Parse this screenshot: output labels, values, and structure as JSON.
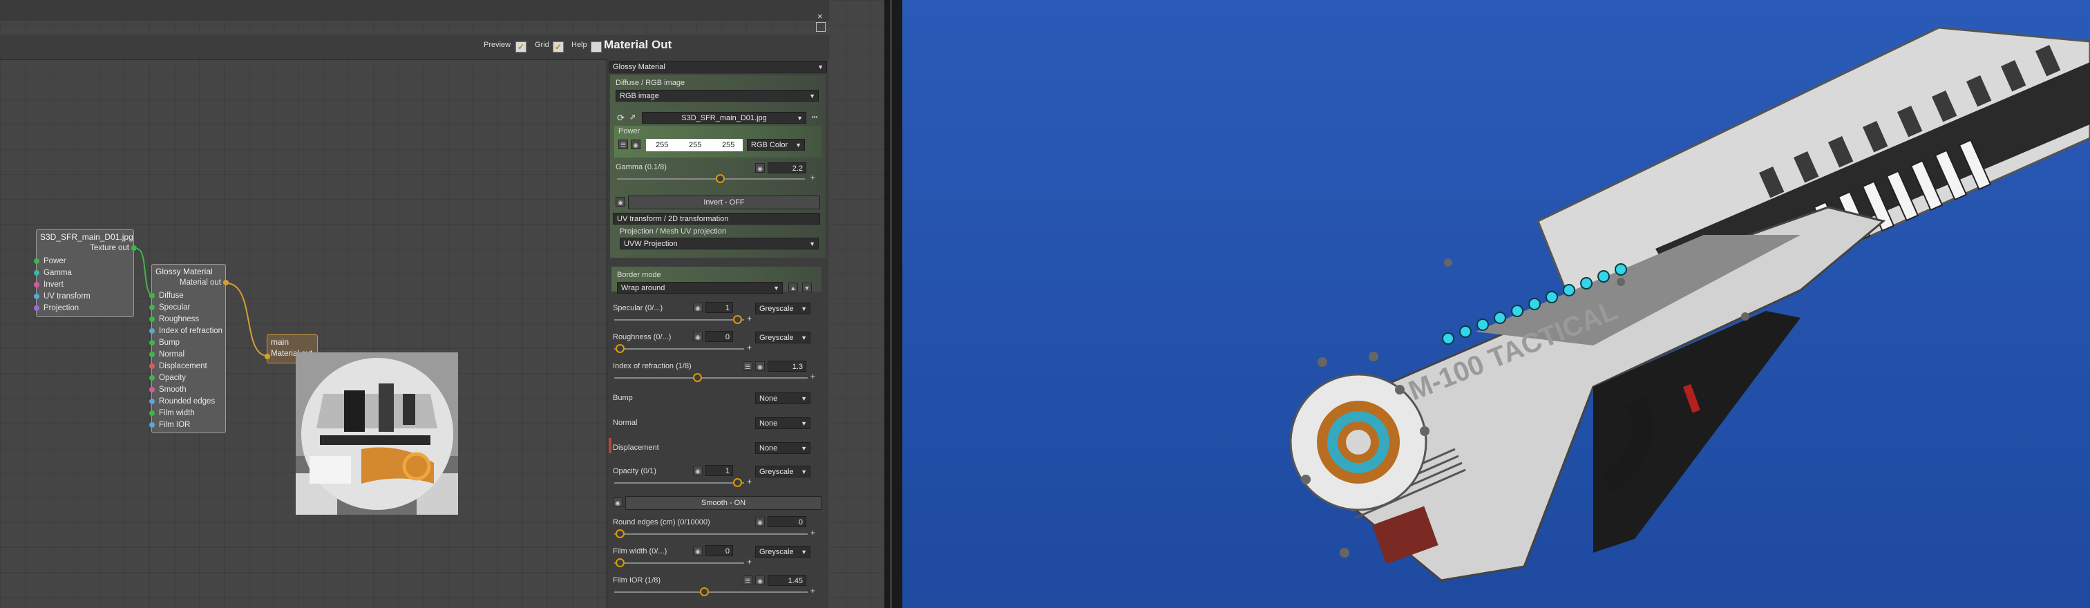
{
  "toolbar": {
    "preview_label": "Preview",
    "grid_label": "Grid",
    "help_label": "Help",
    "panel_title": "Material Out",
    "check_glyph": "✓"
  },
  "nodes": {
    "texture": {
      "title": "S3D_SFR_main_D01.jpg",
      "output": "Texture out",
      "inputs": [
        "Power",
        "Gamma",
        "Invert",
        "UV transform",
        "Projection"
      ]
    },
    "glossy": {
      "title": "Glossy Material",
      "output": "Material out",
      "inputs": [
        "Diffuse",
        "Specular",
        "Roughness",
        "Index of refraction",
        "Bump",
        "Normal",
        "Displacement",
        "Opacity",
        "Smooth",
        "Rounded edges",
        "Film width",
        "Film IOR"
      ]
    },
    "main": {
      "title": "main",
      "input": "Material out"
    }
  },
  "panel": {
    "material_type": "Glossy Material",
    "diffuse_label": "Diffuse / RGB image",
    "diffuse_type": "RGB image",
    "image_file": "S3D_SFR_main_D01.jpg",
    "more_glyph": "•••",
    "power_label": "Power",
    "rgb": [
      "255",
      "255",
      "255"
    ],
    "rgb_mode": "RGB Color",
    "gamma_label": "Gamma (0.1/8)",
    "gamma_value": "2.2",
    "invert_label": "Invert - OFF",
    "uv_transform": "UV transform / 2D transformation",
    "projection_label": "Projection / Mesh UV projection",
    "projection_value": "UVW Projection",
    "border_label": "Border mode",
    "border_value": "Wrap around",
    "specular_label": "Specular (0/...)",
    "specular_value": "1",
    "specular_mode": "Greyscale",
    "roughness_label": "Roughness (0/...)",
    "roughness_value": "0",
    "roughness_mode": "Greyscale",
    "ior_label": "Index of refraction (1/8)",
    "ior_value": "1.3",
    "bump_label": "Bump",
    "bump_value": "None",
    "normal_label": "Normal",
    "normal_value": "None",
    "displacement_label": "Displacement",
    "displacement_value": "None",
    "opacity_label": "Opacity (0/1)",
    "opacity_value": "1",
    "opacity_mode": "Greyscale",
    "smooth_label": "Smooth - ON",
    "round_label": "Round edges (cm) (0/10000)",
    "round_value": "0",
    "film_width_label": "Film width (0/...)",
    "film_width_value": "0",
    "film_width_mode": "Greyscale",
    "film_ior_label": "Film IOR (1/8)",
    "film_ior_value": "1.45"
  },
  "viewport": {
    "weapon_text": "M-100 TACTICAL"
  },
  "colors": {
    "accent": "#e09a00",
    "viewport_bg": "#2452b0",
    "power_green": "#5c7a50"
  }
}
